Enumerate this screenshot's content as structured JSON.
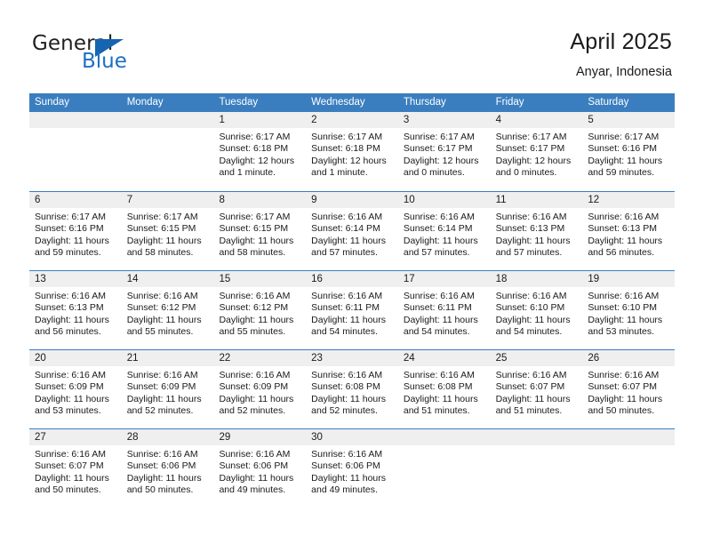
{
  "brand": {
    "name_part1": "General",
    "name_part2": "Blue",
    "accent_color": "#1c6fc4",
    "triangle_color": "#1565b0"
  },
  "header": {
    "title": "April 2025",
    "subtitle": "Anyar, Indonesia"
  },
  "calendar": {
    "header_bg": "#3a7ebf",
    "weekdays": [
      "Sunday",
      "Monday",
      "Tuesday",
      "Wednesday",
      "Thursday",
      "Friday",
      "Saturday"
    ],
    "weeks": [
      [
        {
          "day": "",
          "lines": []
        },
        {
          "day": "",
          "lines": []
        },
        {
          "day": "1",
          "lines": [
            "Sunrise: 6:17 AM",
            "Sunset: 6:18 PM",
            "Daylight: 12 hours",
            "and 1 minute."
          ]
        },
        {
          "day": "2",
          "lines": [
            "Sunrise: 6:17 AM",
            "Sunset: 6:18 PM",
            "Daylight: 12 hours",
            "and 1 minute."
          ]
        },
        {
          "day": "3",
          "lines": [
            "Sunrise: 6:17 AM",
            "Sunset: 6:17 PM",
            "Daylight: 12 hours",
            "and 0 minutes."
          ]
        },
        {
          "day": "4",
          "lines": [
            "Sunrise: 6:17 AM",
            "Sunset: 6:17 PM",
            "Daylight: 12 hours",
            "and 0 minutes."
          ]
        },
        {
          "day": "5",
          "lines": [
            "Sunrise: 6:17 AM",
            "Sunset: 6:16 PM",
            "Daylight: 11 hours",
            "and 59 minutes."
          ]
        }
      ],
      [
        {
          "day": "6",
          "lines": [
            "Sunrise: 6:17 AM",
            "Sunset: 6:16 PM",
            "Daylight: 11 hours",
            "and 59 minutes."
          ]
        },
        {
          "day": "7",
          "lines": [
            "Sunrise: 6:17 AM",
            "Sunset: 6:15 PM",
            "Daylight: 11 hours",
            "and 58 minutes."
          ]
        },
        {
          "day": "8",
          "lines": [
            "Sunrise: 6:17 AM",
            "Sunset: 6:15 PM",
            "Daylight: 11 hours",
            "and 58 minutes."
          ]
        },
        {
          "day": "9",
          "lines": [
            "Sunrise: 6:16 AM",
            "Sunset: 6:14 PM",
            "Daylight: 11 hours",
            "and 57 minutes."
          ]
        },
        {
          "day": "10",
          "lines": [
            "Sunrise: 6:16 AM",
            "Sunset: 6:14 PM",
            "Daylight: 11 hours",
            "and 57 minutes."
          ]
        },
        {
          "day": "11",
          "lines": [
            "Sunrise: 6:16 AM",
            "Sunset: 6:13 PM",
            "Daylight: 11 hours",
            "and 57 minutes."
          ]
        },
        {
          "day": "12",
          "lines": [
            "Sunrise: 6:16 AM",
            "Sunset: 6:13 PM",
            "Daylight: 11 hours",
            "and 56 minutes."
          ]
        }
      ],
      [
        {
          "day": "13",
          "lines": [
            "Sunrise: 6:16 AM",
            "Sunset: 6:13 PM",
            "Daylight: 11 hours",
            "and 56 minutes."
          ]
        },
        {
          "day": "14",
          "lines": [
            "Sunrise: 6:16 AM",
            "Sunset: 6:12 PM",
            "Daylight: 11 hours",
            "and 55 minutes."
          ]
        },
        {
          "day": "15",
          "lines": [
            "Sunrise: 6:16 AM",
            "Sunset: 6:12 PM",
            "Daylight: 11 hours",
            "and 55 minutes."
          ]
        },
        {
          "day": "16",
          "lines": [
            "Sunrise: 6:16 AM",
            "Sunset: 6:11 PM",
            "Daylight: 11 hours",
            "and 54 minutes."
          ]
        },
        {
          "day": "17",
          "lines": [
            "Sunrise: 6:16 AM",
            "Sunset: 6:11 PM",
            "Daylight: 11 hours",
            "and 54 minutes."
          ]
        },
        {
          "day": "18",
          "lines": [
            "Sunrise: 6:16 AM",
            "Sunset: 6:10 PM",
            "Daylight: 11 hours",
            "and 54 minutes."
          ]
        },
        {
          "day": "19",
          "lines": [
            "Sunrise: 6:16 AM",
            "Sunset: 6:10 PM",
            "Daylight: 11 hours",
            "and 53 minutes."
          ]
        }
      ],
      [
        {
          "day": "20",
          "lines": [
            "Sunrise: 6:16 AM",
            "Sunset: 6:09 PM",
            "Daylight: 11 hours",
            "and 53 minutes."
          ]
        },
        {
          "day": "21",
          "lines": [
            "Sunrise: 6:16 AM",
            "Sunset: 6:09 PM",
            "Daylight: 11 hours",
            "and 52 minutes."
          ]
        },
        {
          "day": "22",
          "lines": [
            "Sunrise: 6:16 AM",
            "Sunset: 6:09 PM",
            "Daylight: 11 hours",
            "and 52 minutes."
          ]
        },
        {
          "day": "23",
          "lines": [
            "Sunrise: 6:16 AM",
            "Sunset: 6:08 PM",
            "Daylight: 11 hours",
            "and 52 minutes."
          ]
        },
        {
          "day": "24",
          "lines": [
            "Sunrise: 6:16 AM",
            "Sunset: 6:08 PM",
            "Daylight: 11 hours",
            "and 51 minutes."
          ]
        },
        {
          "day": "25",
          "lines": [
            "Sunrise: 6:16 AM",
            "Sunset: 6:07 PM",
            "Daylight: 11 hours",
            "and 51 minutes."
          ]
        },
        {
          "day": "26",
          "lines": [
            "Sunrise: 6:16 AM",
            "Sunset: 6:07 PM",
            "Daylight: 11 hours",
            "and 50 minutes."
          ]
        }
      ],
      [
        {
          "day": "27",
          "lines": [
            "Sunrise: 6:16 AM",
            "Sunset: 6:07 PM",
            "Daylight: 11 hours",
            "and 50 minutes."
          ]
        },
        {
          "day": "28",
          "lines": [
            "Sunrise: 6:16 AM",
            "Sunset: 6:06 PM",
            "Daylight: 11 hours",
            "and 50 minutes."
          ]
        },
        {
          "day": "29",
          "lines": [
            "Sunrise: 6:16 AM",
            "Sunset: 6:06 PM",
            "Daylight: 11 hours",
            "and 49 minutes."
          ]
        },
        {
          "day": "30",
          "lines": [
            "Sunrise: 6:16 AM",
            "Sunset: 6:06 PM",
            "Daylight: 11 hours",
            "and 49 minutes."
          ]
        },
        {
          "day": "",
          "lines": []
        },
        {
          "day": "",
          "lines": []
        },
        {
          "day": "",
          "lines": []
        }
      ]
    ]
  }
}
